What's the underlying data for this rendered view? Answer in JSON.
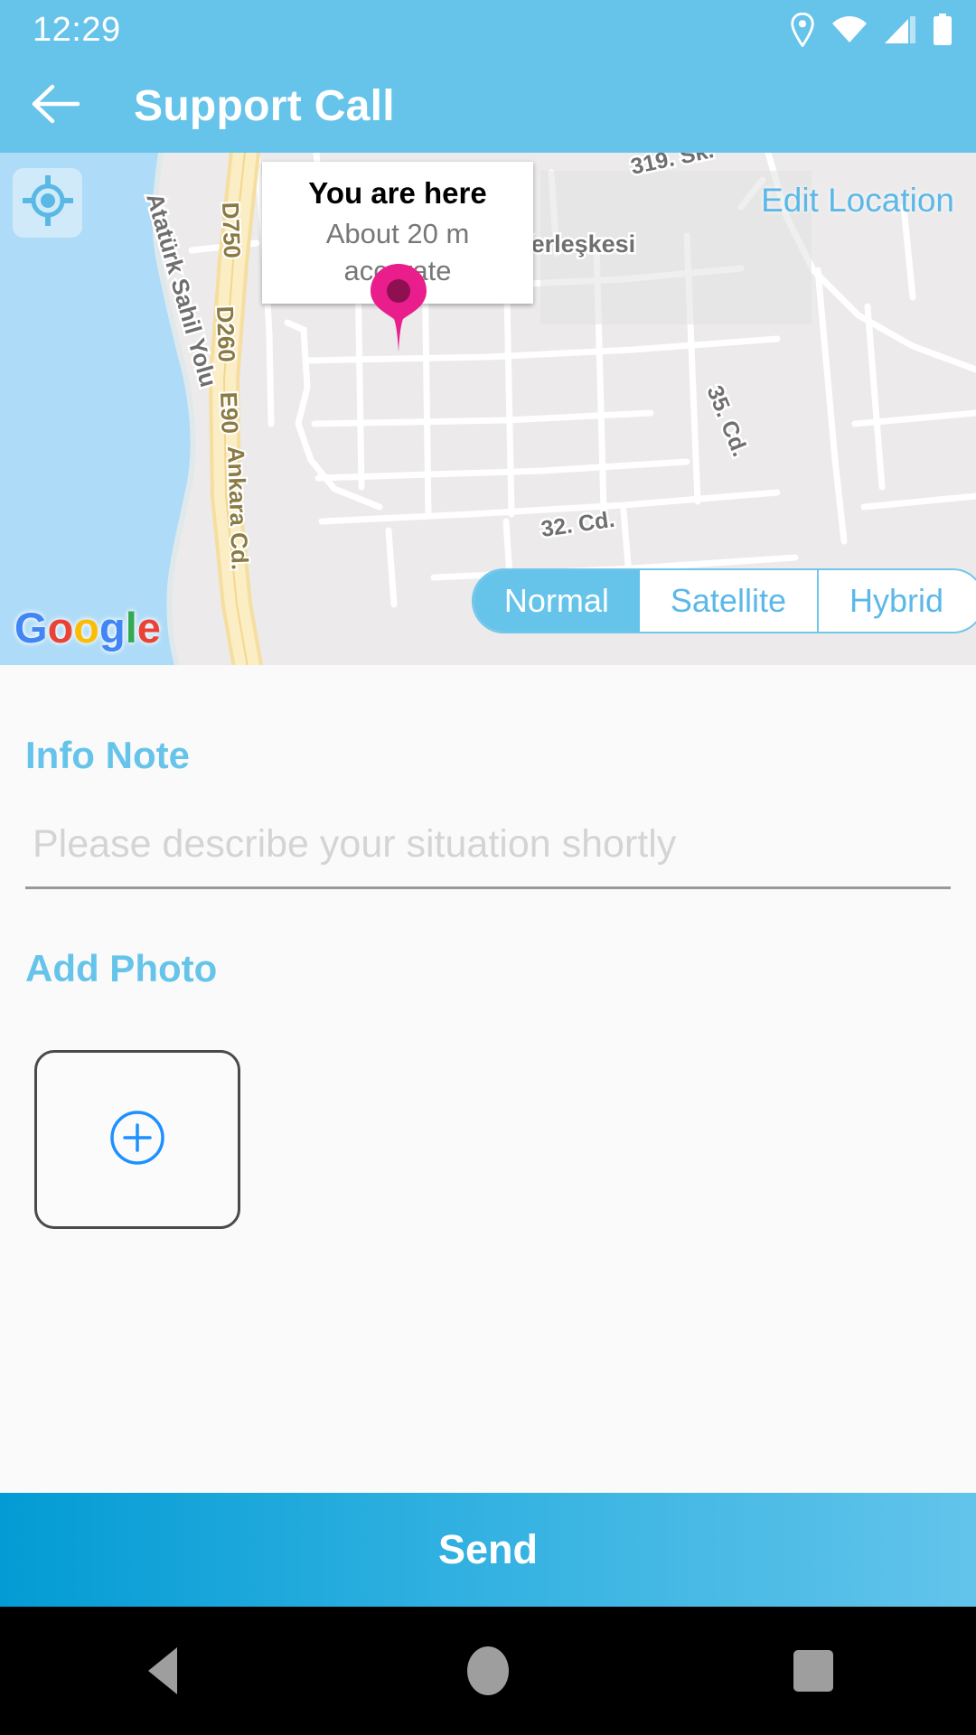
{
  "status_bar": {
    "time": "12:29",
    "icons": [
      "location-pin-icon",
      "wifi-icon",
      "cellular-signal-icon",
      "battery-icon"
    ]
  },
  "app_bar": {
    "back_icon": "arrow-left-icon",
    "title": "Support Call"
  },
  "map": {
    "locate_icon": "my-location-icon",
    "edit_location_label": "Edit Location",
    "info_window": {
      "title": "You are here",
      "subtitle": "About 20 m accurate"
    },
    "attribution": {
      "g1": "G",
      "g2": "o",
      "g3": "o",
      "g4": "g",
      "g5": "l",
      "g6": "e"
    },
    "street_labels": [
      "Atatürk Sahil Yolu",
      "D750",
      "D260",
      "E90",
      "Ankara Cd.",
      "319. Sk.",
      "35. Cd.",
      "32. Cd.",
      "Gazi Ü. Gölbaşı Yerleşkesi"
    ],
    "types": [
      {
        "label": "Normal",
        "selected": true
      },
      {
        "label": "Satellite",
        "selected": false
      },
      {
        "label": "Hybrid",
        "selected": false
      }
    ]
  },
  "form": {
    "info_note_label": "Info Note",
    "info_note_value": "",
    "info_note_placeholder": "Please describe your situation shortly",
    "add_photo_label": "Add Photo",
    "add_photo_icon": "plus-circle-icon"
  },
  "send": {
    "label": "Send"
  },
  "nav_bar": {
    "back": "nav-back-icon",
    "home": "nav-home-icon",
    "recents": "nav-recents-icon"
  },
  "colors": {
    "primary": "#66c4ea",
    "accent_link": "#5bb8e8",
    "pin": "#E91E8C",
    "plus": "#1E90FF",
    "send_gradient_start": "#039BD4",
    "send_gradient_end": "#62C4EB"
  }
}
